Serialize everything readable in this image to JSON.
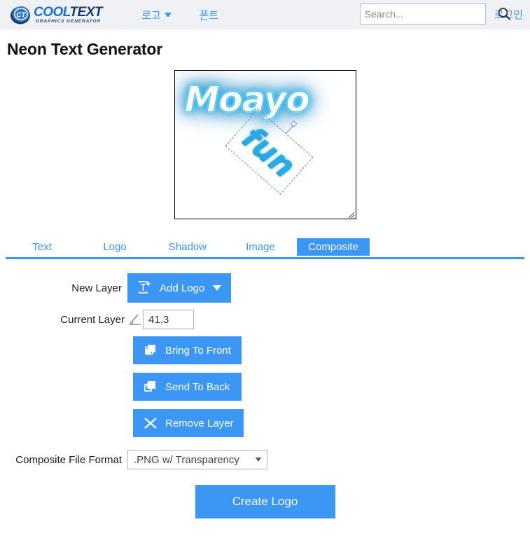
{
  "header": {
    "brand": {
      "badge_icon": "ct-circle-logo-icon",
      "name_part1": "COOL",
      "name_part2": "TEXT",
      "tagline": "GRAPHICS GENERATOR"
    },
    "nav": [
      {
        "label": "로고",
        "has_dropdown": true,
        "icon": "chevron-down-icon"
      },
      {
        "label": "폰트",
        "has_dropdown": false
      }
    ],
    "search": {
      "value": "",
      "placeholder": "Search...",
      "icon": "search-icon"
    },
    "login_label": "로그인"
  },
  "page_title": "Neon Text Generator",
  "canvas": {
    "neon_text": "Moayo",
    "layer_text": "fun",
    "layer_rotation_deg": 41.3,
    "rotate_handle_icon": "rotate-handle-icon",
    "resize_grip_icon": "resize-grip-icon"
  },
  "tabs": [
    {
      "label": "Text",
      "active": false
    },
    {
      "label": "Logo",
      "active": false
    },
    {
      "label": "Shadow",
      "active": false
    },
    {
      "label": "Image",
      "active": false
    },
    {
      "label": "Composite",
      "active": true
    }
  ],
  "form": {
    "new_layer_label": "New Layer",
    "add_logo_label": "Add Logo",
    "add_logo_icon": "add-text-layer-icon",
    "current_layer_label": "Current Layer",
    "angle_icon": "angle-icon",
    "angle_value": "41.3",
    "bring_to_front_label": "Bring To Front",
    "bring_to_front_icon": "bring-to-front-icon",
    "send_to_back_label": "Send To Back",
    "send_to_back_icon": "send-to-back-icon",
    "remove_layer_label": "Remove Layer",
    "remove_layer_icon": "close-x-icon",
    "file_format_label": "Composite File Format",
    "file_format_value": ".PNG w/ Transparency",
    "create_label": "Create Logo"
  },
  "colors": {
    "accent_blue": "#3b97f3",
    "header_bg": "#f0f1f5",
    "neon_cyan": "#37c3f2",
    "selection_border": "#7b86d8"
  }
}
